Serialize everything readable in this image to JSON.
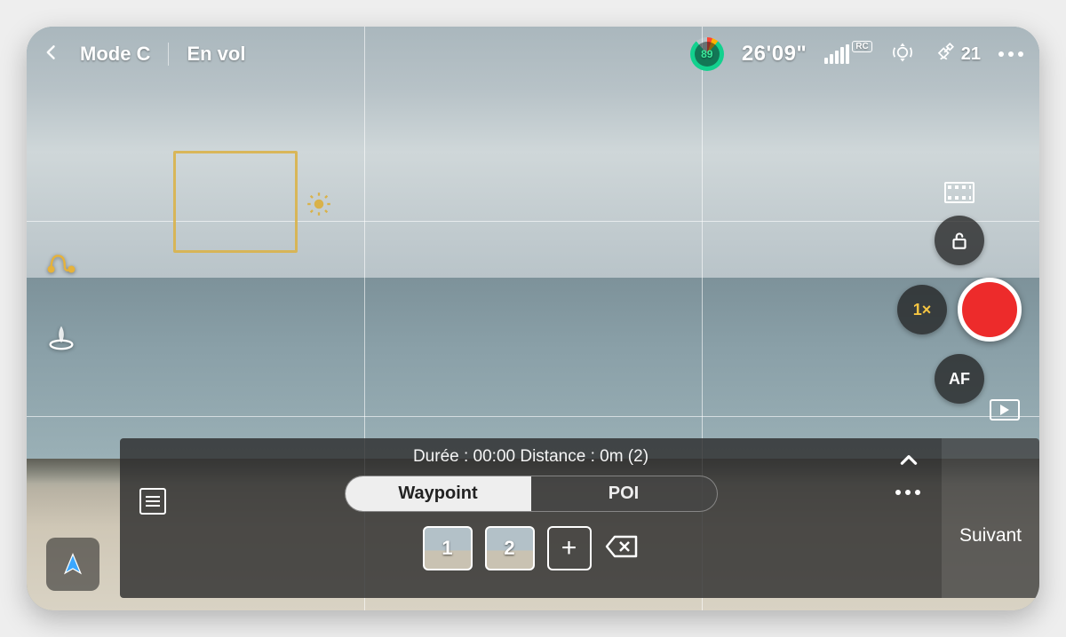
{
  "topbar": {
    "mode_label": "Mode C",
    "status_label": "En vol",
    "battery_percent": "89",
    "record_time": "26'09\"",
    "rc_badge": "RC",
    "sat_count": "21"
  },
  "camera": {
    "zoom_label": "1×",
    "focus_label": "AF"
  },
  "panel": {
    "info_line": "Durée : 00:00 Distance : 0m (2)",
    "tab_waypoint": "Waypoint",
    "tab_poi": "POI",
    "waypoints": [
      "1",
      "2"
    ],
    "next_label": "Suivant"
  }
}
